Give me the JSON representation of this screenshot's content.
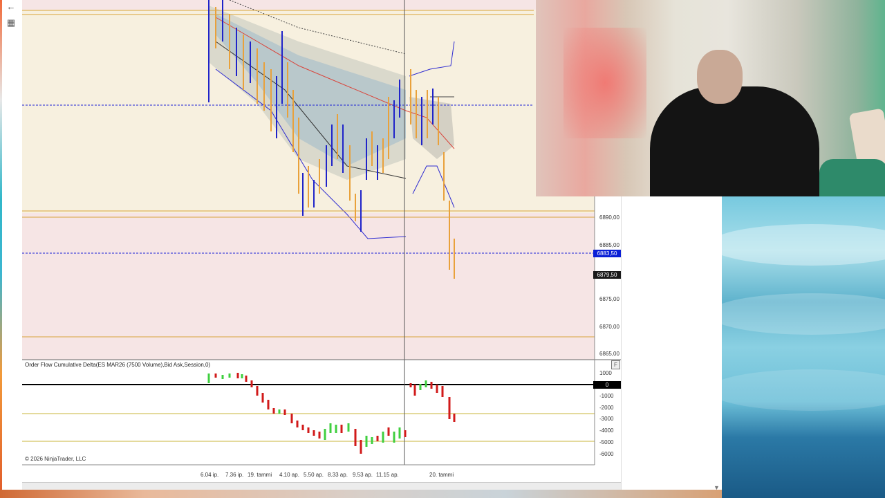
{
  "nav": {
    "back_icon": "←",
    "grid_icon": "▦"
  },
  "price_axis": {
    "labels": [
      "6890,00",
      "6885,00",
      "6875,00",
      "6870,00",
      "6865,00"
    ],
    "current_price_tag": "6883,50",
    "last_price_tag": "6879,50",
    "current_tag_color": "#0a1fd6",
    "last_tag_color": "#1a1a1a"
  },
  "indicator": {
    "title": "Order Flow Cumulative Delta(ES MAR26 (7500 Volume),Bid Ask,Session,0)",
    "axis_labels": [
      "1000",
      "0",
      "-1000",
      "-2000",
      "-3000",
      "-4000",
      "-5000",
      "-6000"
    ],
    "panel_button": "F"
  },
  "copyright": "© 2026 NinjaTrader, LLC",
  "time_axis": [
    "6.04 ip.",
    "7.36 ip.",
    "19. tammi",
    "4.10 ap.",
    "5.50 ap.",
    "8.33 ap.",
    "9.53 ap.",
    "11.15 ap.",
    "20. tammi"
  ],
  "colors": {
    "chart_bg_cream": "#f7f0df",
    "chart_bg_pink": "#f6e5e5",
    "up_bar": "#1f23c9",
    "down_bar": "#e9a13b",
    "level_line": "#d8a33a",
    "dashed_line": "#1b1fd6",
    "delta_up": "#3fcf3f",
    "delta_down": "#d11a1a"
  }
}
